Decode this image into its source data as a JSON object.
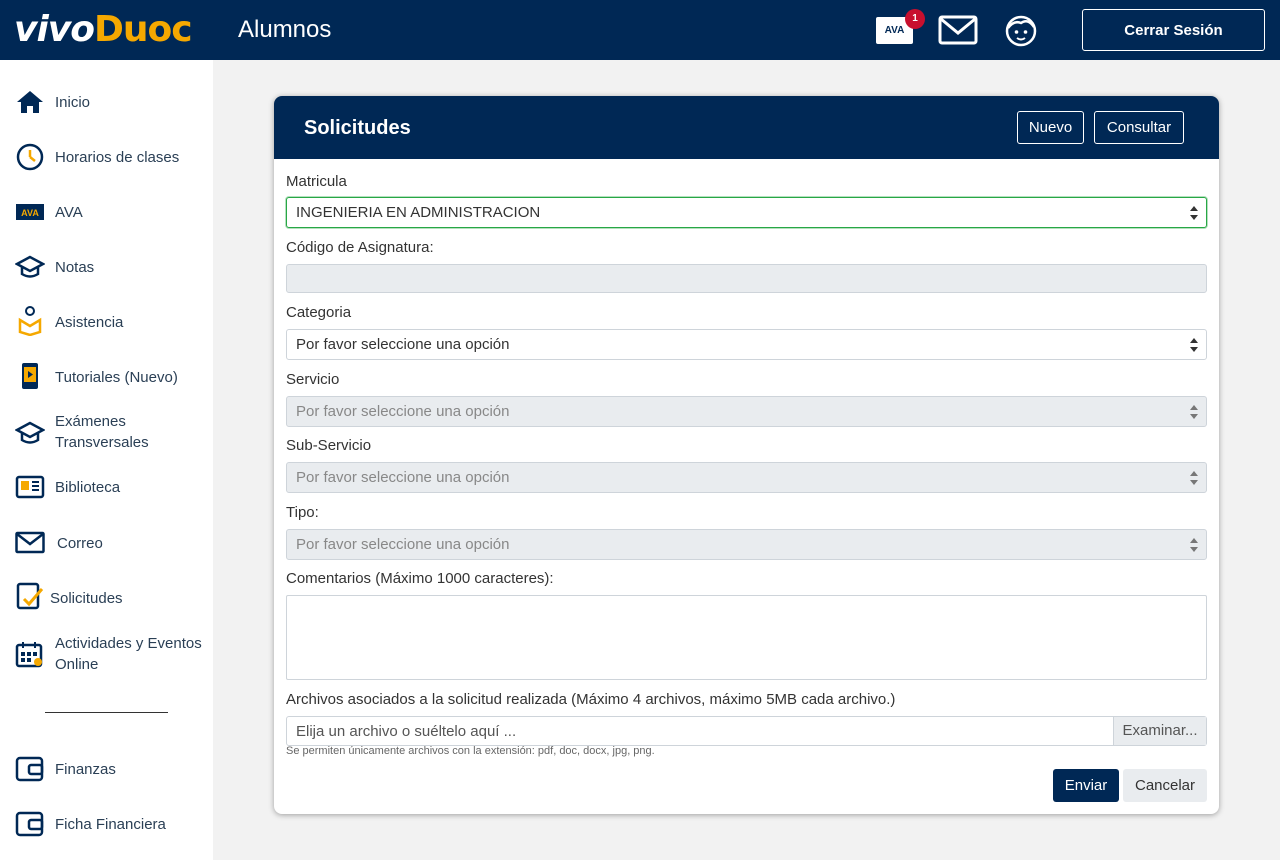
{
  "header": {
    "logo_part1": "vivo",
    "logo_part2": "Duoc",
    "title": "Alumnos",
    "ava_label": "AVA",
    "ava_badge": "1",
    "mail_icon": "mail-icon",
    "profile_icon": "face-icon",
    "logout_label": "Cerrar Sesión"
  },
  "sidebar": {
    "items": [
      {
        "label": "Inicio",
        "icon": "home-icon"
      },
      {
        "label": "Horarios de clases",
        "icon": "clock-icon"
      },
      {
        "label": "AVA",
        "icon": "ava-icon"
      },
      {
        "label": "Notas",
        "icon": "graduation-cap-icon"
      },
      {
        "label": "Asistencia",
        "icon": "attendance-icon"
      },
      {
        "label": "Tutoriales (Nuevo)",
        "icon": "tablet-play-icon"
      },
      {
        "label": "Exámenes Transversales",
        "icon": "graduation-cap-icon"
      },
      {
        "label": "Biblioteca",
        "icon": "library-icon"
      },
      {
        "label": "Correo",
        "icon": "mail-icon"
      },
      {
        "label": "Solicitudes",
        "icon": "checklist-icon"
      },
      {
        "label": "Actividades y Eventos Online",
        "icon": "calendar-icon"
      },
      {
        "label": "Finanzas",
        "icon": "wallet-icon"
      },
      {
        "label": "Ficha Financiera",
        "icon": "wallet-icon"
      }
    ]
  },
  "card": {
    "title": "Solicitudes",
    "new_label": "Nuevo",
    "consult_label": "Consultar"
  },
  "form": {
    "matricula_label": "Matricula",
    "matricula_value": "INGENIERIA EN ADMINISTRACION",
    "codigo_label": "Código de Asignatura:",
    "categoria_label": "Categoria",
    "categoria_value": "Por favor seleccione una opción",
    "servicio_label": "Servicio",
    "servicio_value": "Por favor seleccione una opción",
    "subservicio_label": "Sub-Servicio",
    "subservicio_value": "Por favor seleccione una opción",
    "tipo_label": "Tipo:",
    "tipo_value": "Por favor seleccione una opción",
    "comentarios_label": "Comentarios (Máximo 1000 caracteres):",
    "archivos_label": "Archivos asociados a la solicitud realizada (Máximo 4 archivos, máximo 5MB cada archivo.)",
    "file_placeholder": "Elija un archivo o suéltelo aquí ...",
    "browse_label": "Examinar...",
    "file_hint": "Se permiten únicamente archivos con la extensión: pdf, doc, docx, jpg, png.",
    "submit_label": "Enviar",
    "cancel_label": "Cancelar"
  },
  "colors": {
    "primary": "#002855",
    "accent": "#f5a800",
    "badge": "#c8102e",
    "focus": "#28a745"
  }
}
